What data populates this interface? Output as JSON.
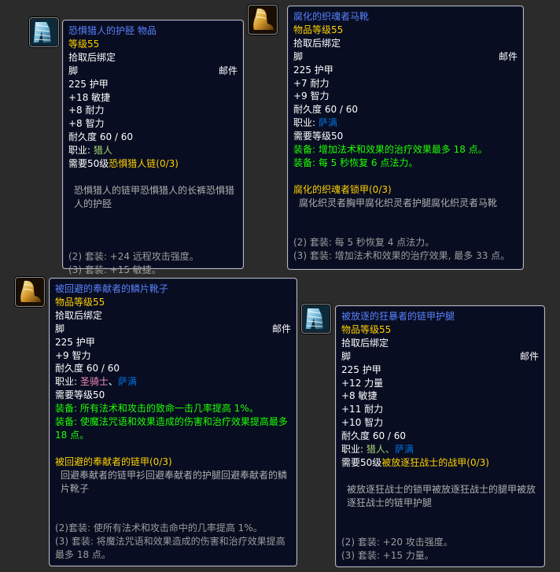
{
  "colors": {
    "title": "#5b82ff",
    "gold": "#ffd100",
    "green": "#1eff00",
    "paladin": "#f58cba",
    "shaman": "#0070de",
    "hunter": "#abd473",
    "gray": "#9d9d9d"
  },
  "tooltips": [
    {
      "icon": "mail-leggings-icon",
      "title": "恐惧猎人的护胫 物品",
      "item_level": "等级55",
      "binding": "拾取后绑定",
      "slot": "脚",
      "armor_type": "邮件",
      "stats": [
        "225 护甲",
        "+18 敏捷",
        "+8 耐力",
        "+8 智力"
      ],
      "durability": "耐久度 60 / 60",
      "class_prefix": "职业: ",
      "classes": [
        "猎人"
      ],
      "req_prefix": "需要50级",
      "req_set": "恐惧猎人链(0/3)",
      "set_pieces": "恐惧猎人的链甲恐惧猎人的长裤恐惧猎人的护胫",
      "bonuses": [
        "(2) 套装: +24 远程攻击强度。",
        "(3) 套装: +15 敏捷。"
      ]
    },
    {
      "icon": "golden-boots-icon",
      "title": "腐化的织魂者马靴",
      "item_level": "物品等级55",
      "binding": "拾取后绑定",
      "slot": "脚",
      "armor_type": "邮件",
      "stats": [
        "225 护甲",
        "+7 耐力",
        "+9 智力"
      ],
      "durability": "耐久度 60 / 60",
      "class_prefix": "职业: ",
      "classes": [
        "萨满"
      ],
      "requirement": "需要等级50",
      "equips": [
        "装备: 增加法术和效果的治疗效果最多 18 点。",
        "装备: 每 5 秒恢复 6 点法力。"
      ],
      "set_name": "腐化的织魂者锁甲(0/3)",
      "set_pieces": "腐化织灵者胸甲腐化织灵者护腿腐化织灵者马靴",
      "bonuses": [
        "(2) 套装: 每 5 秒恢复 4 点法力。",
        "(3) 套装: 增加法术和效果的治疗效果, 最多 33 点。"
      ]
    },
    {
      "icon": "golden-boots-icon",
      "title": "被回避的奉献者的鳞片靴子",
      "item_level": "物品等级55",
      "binding": "拾取后绑定",
      "slot": "脚",
      "armor_type": "邮件",
      "stats": [
        "225 护甲",
        "+9 智力"
      ],
      "durability": "耐久度 60 / 60",
      "class_prefix": "职业: ",
      "classes": [
        "圣骑士",
        "萨满"
      ],
      "class_sep": "、",
      "requirement": "需要等级50",
      "equips": [
        "装备: 所有法术和攻击的致命一击几率提高 1%。",
        "装备: 使魔法咒语和效果造成的伤害和治疗效果提高最多 18 点。"
      ],
      "set_name": "被回避的奉献者的链甲(0/3)",
      "set_pieces": "回避奉献者的链甲衫回避奉献者的护腿回避奉献者的鳞片靴子",
      "bonuses": [
        "(2)套装: 使所有法术和攻击命中的几率提高 1%。",
        "(3) 套装: 将魔法咒语和效果造成的伤害和治疗效果提高最多 18 点。"
      ]
    },
    {
      "icon": "mail-leggings-icon",
      "title": "被放逐的狂暴者的链甲护腿",
      "item_level": "物品等级55",
      "binding": "拾取后绑定",
      "slot": "脚",
      "armor_type": "邮件",
      "stats": [
        "225 护甲",
        "+12 力量",
        "+8 敏捷",
        "+11 耐力",
        "+10 智力"
      ],
      "durability": "耐久度 60 / 60",
      "class_prefix": "职业: ",
      "classes": [
        "猎人",
        "萨满"
      ],
      "class_sep": "、",
      "req_prefix": "需要50级",
      "req_set": "被放逐狂战士的战甲(0/3)",
      "set_pieces": "被放逐狂战士的锁甲被放逐狂战士的腿甲被放逐狂战士的链甲护腿",
      "bonuses": [
        "(2) 套装: +20 攻击强度。",
        "(3) 套装: +15 力量。"
      ]
    }
  ]
}
